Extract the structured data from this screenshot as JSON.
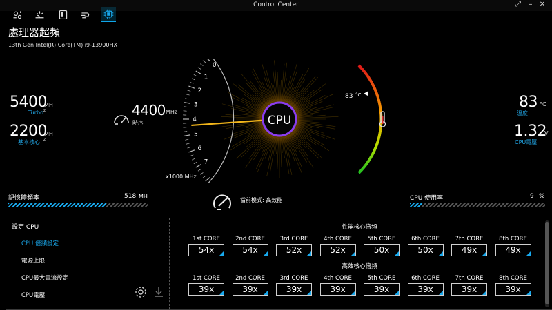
{
  "window": {
    "title": "Control Center"
  },
  "tabs": [
    {
      "name": "settings-gears-icon",
      "active": false
    },
    {
      "name": "brightness-icon",
      "active": false
    },
    {
      "name": "fan-icon",
      "active": false
    },
    {
      "name": "power-icon",
      "active": false
    },
    {
      "name": "cpu-chip-icon",
      "active": true
    }
  ],
  "page": {
    "title": "處理器超頻",
    "cpu_model": "13th Gen Intel(R) Core(TM) i9-13900HX"
  },
  "left": {
    "turbo_value": "5400",
    "turbo_unit": "MH",
    "turbo_unit2": "z",
    "turbo_label": "Turbo",
    "base_value": "2200",
    "base_unit": "MH",
    "base_unit2": "z",
    "base_label": "基本核心"
  },
  "gauge": {
    "current_value": "4400",
    "current_unit": "MHz",
    "current_label": "時序",
    "scale_unit": "x1000 MHz",
    "ticks": [
      "0",
      "1",
      "2",
      "3",
      "4",
      "5",
      "6",
      "7"
    ],
    "center_label": "CPU",
    "temp_marker": "83",
    "temp_marker_unit": "°C",
    "needle_ghz": 4.4
  },
  "right": {
    "temp_value": "83",
    "temp_unit": "°C",
    "temp_label": "溫度",
    "volt_value": "1.32",
    "volt_unit": "V",
    "volt_label": "CPU電壓"
  },
  "memory": {
    "label": "記憶體頻率",
    "value": "518",
    "unit": "MH",
    "fill_fraction": 0.7
  },
  "cpu_usage": {
    "label": "CPU 使用率",
    "value": "9",
    "unit": "%",
    "fill_fraction": 0.09
  },
  "mode": {
    "text": "當前模式: 高效能"
  },
  "settings": {
    "heading": "設定 CPU",
    "menu": [
      "CPU 倍頻設定",
      "電源上限",
      "CPU最大電流設定",
      "CPU電壓"
    ],
    "active_index": 0
  },
  "performance_cores": {
    "title": "性能核心倍頻",
    "cores": [
      {
        "name": "1st CORE",
        "value": "54x"
      },
      {
        "name": "2nd CORE",
        "value": "54x"
      },
      {
        "name": "3rd CORE",
        "value": "52x"
      },
      {
        "name": "4th CORE",
        "value": "52x"
      },
      {
        "name": "5th CORE",
        "value": "50x"
      },
      {
        "name": "6th CORE",
        "value": "50x"
      },
      {
        "name": "7th CORE",
        "value": "49x"
      },
      {
        "name": "8th CORE",
        "value": "49x"
      }
    ]
  },
  "efficient_cores": {
    "title": "高效核心倍頻",
    "cores": [
      {
        "name": "1st CORE",
        "value": "39x"
      },
      {
        "name": "2nd CORE",
        "value": "39x"
      },
      {
        "name": "3rd CORE",
        "value": "39x"
      },
      {
        "name": "4th CORE",
        "value": "39x"
      },
      {
        "name": "5th CORE",
        "value": "39x"
      },
      {
        "name": "6th CORE",
        "value": "39x"
      },
      {
        "name": "7th CORE",
        "value": "39x"
      },
      {
        "name": "8th CORE",
        "value": "39x"
      }
    ]
  },
  "colors": {
    "accent": "#18a9ee",
    "needle": "#f2b51a",
    "glow": "#f5b800",
    "ring": "#8a3df0"
  }
}
